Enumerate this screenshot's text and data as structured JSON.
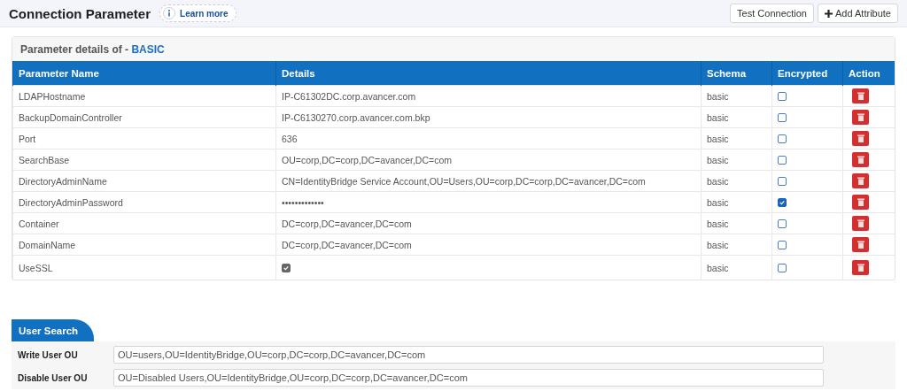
{
  "header": {
    "title": "Connection Parameter",
    "learn_more": "Learn more",
    "buttons": [
      {
        "label": "Test Connection",
        "kind": "plain"
      },
      {
        "label": "Add Attribute",
        "kind": "add"
      }
    ]
  },
  "card": {
    "title": "Parameter details of - ",
    "title_accent": "BASIC"
  },
  "table": {
    "columns": [
      "Parameter Name",
      "Details",
      "Schema",
      "Encrypted",
      "Action"
    ],
    "rows": [
      {
        "name": "LDAPHostname",
        "details": "IP-C61302DC.corp.avancer.com",
        "kind": "text",
        "schema": "basic",
        "encrypted": false
      },
      {
        "name": "BackupDomainController",
        "details": "IP-C6130270.corp.avancer.com.bkp",
        "kind": "text",
        "schema": "basic",
        "encrypted": false
      },
      {
        "name": "Port",
        "details": "636",
        "kind": "text",
        "schema": "basic",
        "encrypted": false
      },
      {
        "name": "SearchBase",
        "details": "OU=corp,DC=corp,DC=avancer,DC=com",
        "kind": "text",
        "schema": "basic",
        "encrypted": false
      },
      {
        "name": "DirectoryAdminName",
        "details": "CN=IdentityBridge Service Account,OU=Users,OU=corp,DC=corp,DC=avancer,DC=com",
        "kind": "text",
        "schema": "basic",
        "encrypted": false
      },
      {
        "name": "DirectoryAdminPassword",
        "details": "•••••••••••••",
        "kind": "text",
        "schema": "basic",
        "encrypted": true
      },
      {
        "name": "Container",
        "details": "DC=corp,DC=avancer,DC=com",
        "kind": "text",
        "schema": "basic",
        "encrypted": false
      },
      {
        "name": "DomainName",
        "details": "DC=corp,DC=avancer,DC=com",
        "kind": "text",
        "schema": "basic",
        "encrypted": false
      },
      {
        "name": "UseSSL",
        "checked": true,
        "kind": "checkbox",
        "schema": "basic",
        "encrypted": false
      }
    ]
  },
  "user_search": {
    "tab": "User Search",
    "fields": [
      {
        "label": "Write User OU",
        "value": "OU=users,OU=IdentityBridge,OU=corp,DC=corp,DC=avancer,DC=com"
      },
      {
        "label": "Disable User OU",
        "value": "OU=Disabled Users,OU=IdentityBridge,OU=corp,DC=corp,DC=avancer,DC=com"
      }
    ]
  }
}
